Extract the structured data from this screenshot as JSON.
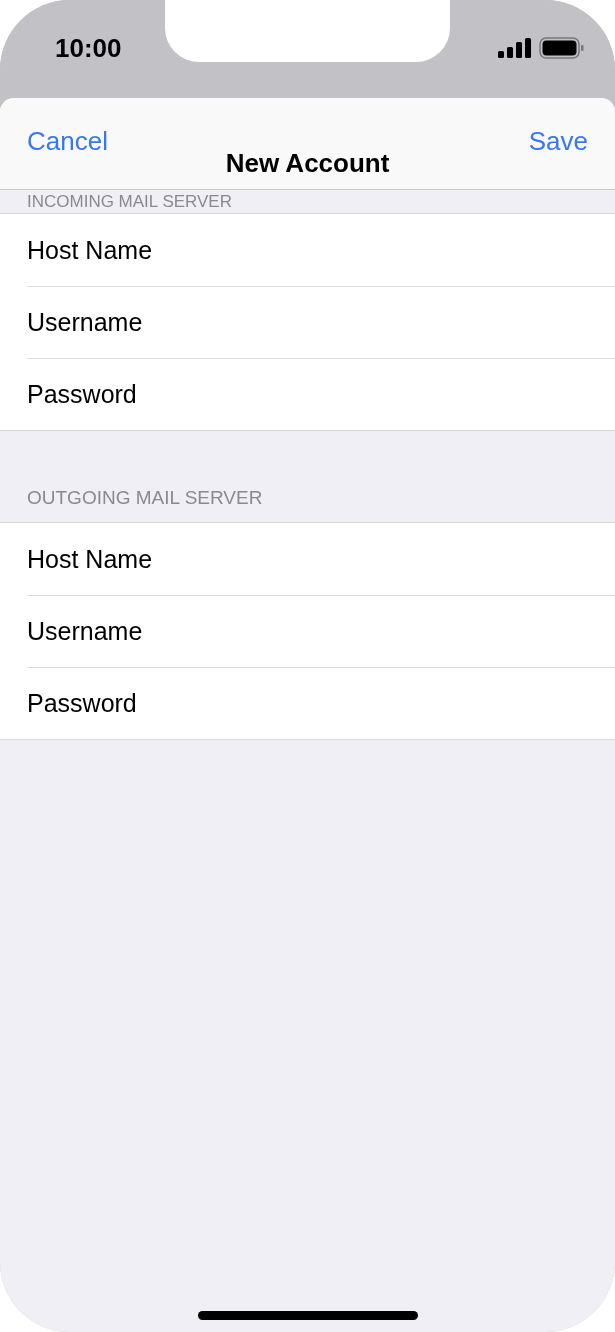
{
  "status_bar": {
    "time": "10:00"
  },
  "nav": {
    "title": "New Account",
    "left_button": "Cancel",
    "right_button": "Save"
  },
  "sections": [
    {
      "header": "INCOMING MAIL SERVER",
      "compact_header": true,
      "rows": [
        {
          "label": "Host Name"
        },
        {
          "label": "Username"
        },
        {
          "label": "Password"
        }
      ]
    },
    {
      "header": "OUTGOING MAIL SERVER",
      "compact_header": false,
      "rows": [
        {
          "label": "Host Name"
        },
        {
          "label": "Username"
        },
        {
          "label": "Password"
        }
      ]
    }
  ]
}
